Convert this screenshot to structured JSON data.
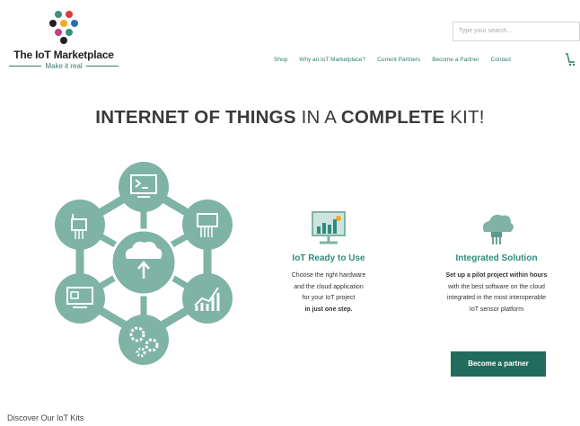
{
  "brand": {
    "title": "The IoT Marketplace",
    "tagline": "Make it real"
  },
  "search": {
    "placeholder": "Type your search..."
  },
  "nav": {
    "items": [
      "Shop",
      "Why an IoT Marketplace?",
      "Current Partners",
      "Become a Partner",
      "Contact"
    ]
  },
  "hero": {
    "headline_bold1": "INTERNET OF THINGS",
    "headline_thin1": " IN A ",
    "headline_bold2": "COMPLETE",
    "headline_thin2": " KIT!"
  },
  "features": [
    {
      "icon": "monitor-chart-icon",
      "title": "IoT Ready to Use",
      "line1": "Choose the right hardware",
      "line2": "and the cloud application",
      "line3": "for your IoT project",
      "line4": "in just one step."
    },
    {
      "icon": "cloud-sensor-icon",
      "title": "Integrated Solution",
      "line1": "Set up a pilot project within hours",
      "line2": "with the best software on the cloud",
      "line3": "integrated in the most interoperable",
      "line4": "IoT sensor platform"
    }
  ],
  "cta": {
    "label": "Become a partner"
  },
  "section": {
    "title": "Discover Our IoT Kits"
  },
  "colors": {
    "teal": "#7fb3a6",
    "accent": "#2f8c7c",
    "button": "#236b5e"
  }
}
